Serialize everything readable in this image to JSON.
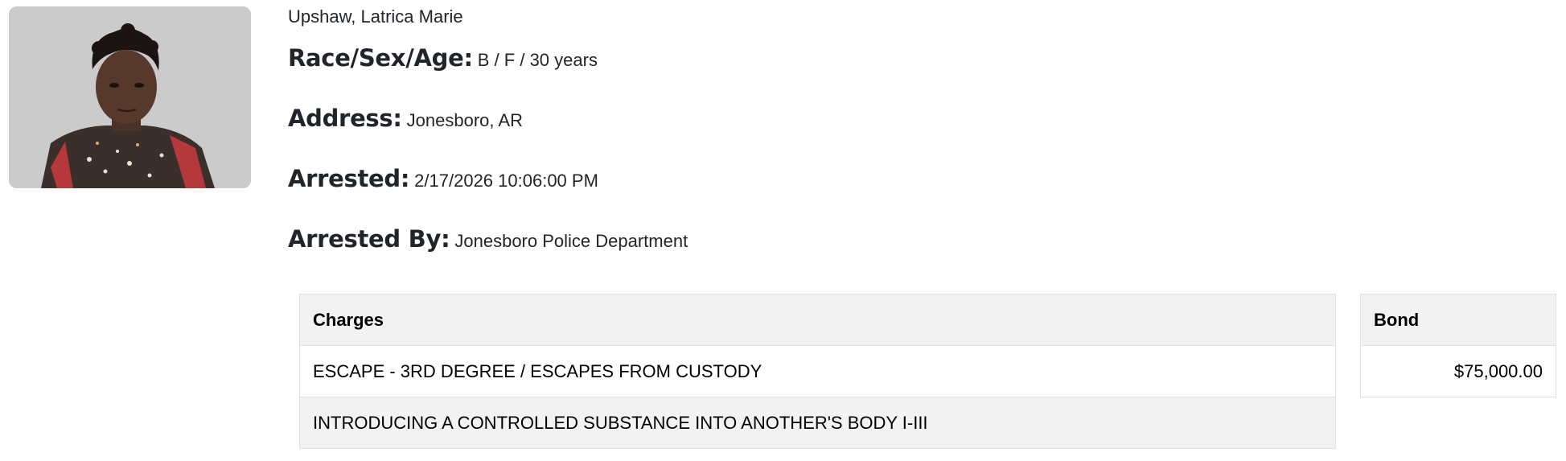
{
  "inmate": {
    "name": "Upshaw, Latrica Marie",
    "photo_icon": "mugshot-photo"
  },
  "fields": {
    "race_sex_age_label": "Race/Sex/Age:",
    "race_sex_age_value": "B / F / 30 years",
    "address_label": "Address:",
    "address_value": "Jonesboro, AR",
    "arrested_label": "Arrested:",
    "arrested_value": "2/17/2026 10:06:00 PM",
    "arrested_by_label": "Arrested By:",
    "arrested_by_value": "Jonesboro Police Department"
  },
  "charges": {
    "header": "Charges",
    "rows": [
      "ESCAPE - 3RD DEGREE / ESCAPES FROM CUSTODY",
      "INTRODUCING A CONTROLLED SUBSTANCE INTO ANOTHER'S BODY I-III"
    ]
  },
  "bond": {
    "header": "Bond",
    "rows": [
      "$75,000.00"
    ]
  }
}
